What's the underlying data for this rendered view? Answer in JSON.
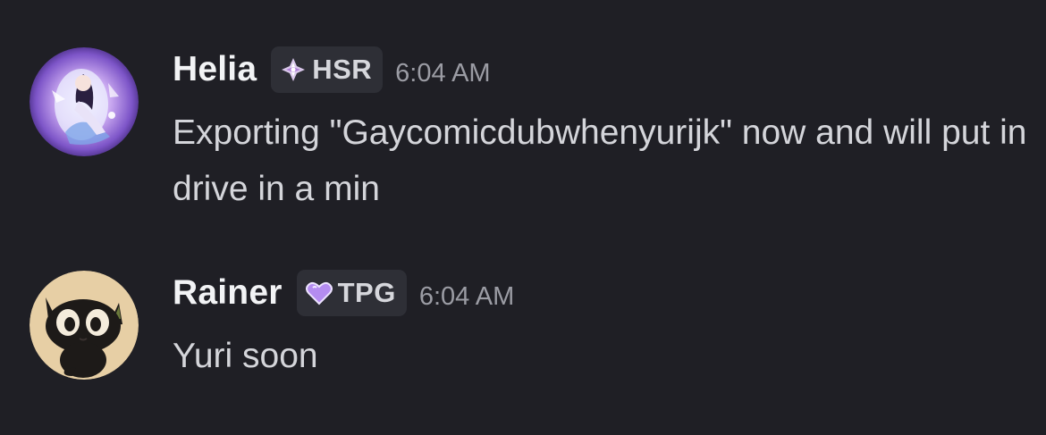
{
  "messages": [
    {
      "author": "Helia",
      "tag": {
        "label": "HSR",
        "icon": "diamond-sparkle-icon",
        "color": "#c9a5e6"
      },
      "timestamp": "6:04 AM",
      "content": "Exporting \"Gaycomicdubwhenyurijk\" now and will put in drive in a min",
      "avatar": "anime-character-avatar"
    },
    {
      "author": "Rainer",
      "tag": {
        "label": "TPG",
        "icon": "purple-heart-icon",
        "color": "#b48cf0"
      },
      "timestamp": "6:04 AM",
      "content": "Yuri soon",
      "avatar": "black-cat-avatar"
    }
  ],
  "colors": {
    "background": "#1f1f25",
    "username": "#f2f3f5",
    "text": "#d4d5da",
    "timestamp": "#9b9ca4",
    "tag_background": "#2e2f36"
  }
}
